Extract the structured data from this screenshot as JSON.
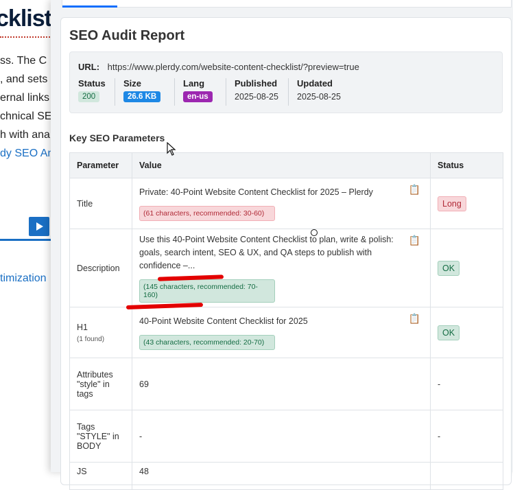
{
  "background": {
    "title": "cklist",
    "lines": [
      "ss. The C",
      ", and sets",
      "ernal links",
      "chnical SE",
      "h with ana"
    ],
    "link": "dy SEO An",
    "link2": "timization"
  },
  "panel": {
    "title": "SEO Audit Report",
    "url_label": "URL:",
    "url": "https://www.plerdy.com/website-content-checklist/?preview=true",
    "status_label": "Status",
    "status": "200",
    "size_label": "Size",
    "size": "26.6 KB",
    "lang_label": "Lang",
    "lang": "en-us",
    "published_label": "Published",
    "published": "2025-08-25",
    "updated_label": "Updated",
    "updated": "2025-08-25",
    "section_title": "Key SEO Parameters",
    "table": {
      "headers": [
        "Parameter",
        "Value",
        "Status"
      ],
      "rows": [
        {
          "param": "Title",
          "value": "Private: 40-Point Website Content Checklist for 2025 – Plerdy",
          "hint": "(61 characters, recommended: 30-60)",
          "status": "Long"
        },
        {
          "param": "Description",
          "value": "Use this 40-Point Website Content Checklist to plan, write & polish: goals, search intent, SEO & UX, and QA steps to publish with confidence –...",
          "hint": "(145 characters, recommended: 70-160)",
          "status": "OK"
        },
        {
          "param": "H1",
          "sub": "(1 found)",
          "value": "40-Point Website Content Checklist for 2025",
          "hint": "(43 characters, recommended: 20-70)",
          "status": "OK"
        },
        {
          "param": "Attributes \"style\" in tags",
          "value": "69",
          "status": "-"
        },
        {
          "param": "Tags \"STYLE\" in BODY",
          "value": "-",
          "status": "-"
        },
        {
          "param": "JS",
          "value": "48",
          "status": ""
        }
      ]
    }
  },
  "colors": {
    "accent": "#0d6efd",
    "ok": "#d1e7dd",
    "warn": "#f8d7da",
    "marker": "#e30000"
  }
}
